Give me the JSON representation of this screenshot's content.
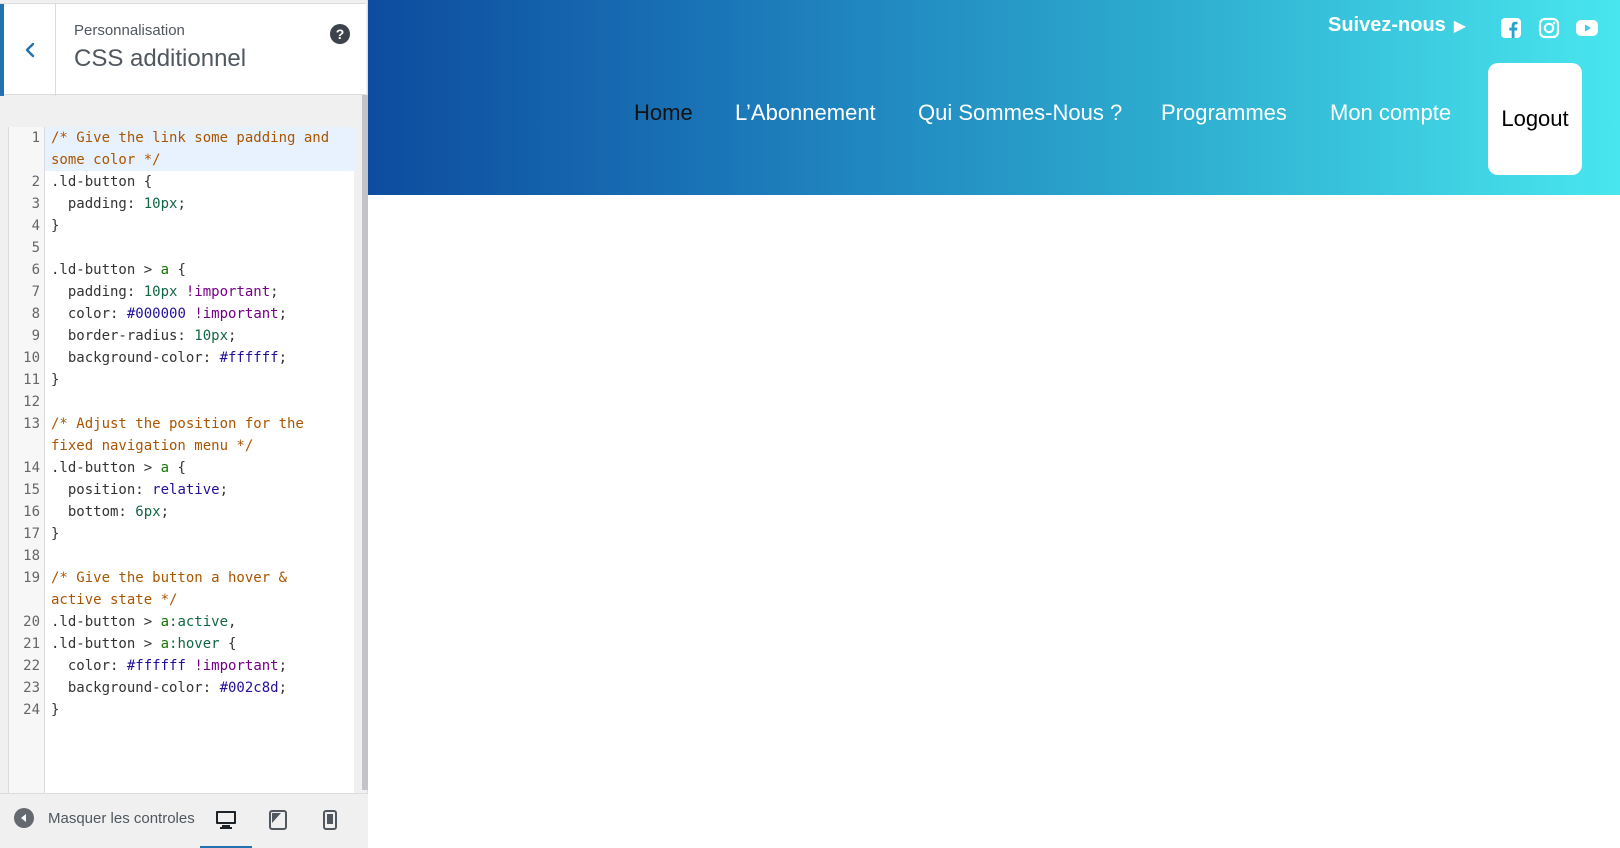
{
  "sidebar": {
    "breadcrumb": "Personnalisation",
    "title": "CSS additionnel",
    "code": [
      [
        {
          "t": "/* Give the link some padding and",
          "c": "comment"
        }
      ],
      [
        {
          "t": "some color */",
          "c": "comment"
        }
      ],
      [
        {
          "t": ".ld-button {",
          "c": ""
        }
      ],
      [
        {
          "t": "  padding: ",
          "c": ""
        },
        {
          "t": "10px",
          "c": "num"
        },
        {
          "t": ";",
          "c": ""
        }
      ],
      [
        {
          "t": "}",
          "c": ""
        }
      ],
      [],
      [
        {
          "t": ".ld-button > ",
          "c": ""
        },
        {
          "t": "a",
          "c": "tag"
        },
        {
          "t": " {",
          "c": ""
        }
      ],
      [
        {
          "t": "  padding: ",
          "c": ""
        },
        {
          "t": "10px",
          "c": "num"
        },
        {
          "t": " ",
          "c": ""
        },
        {
          "t": "!important",
          "c": "kw"
        },
        {
          "t": ";",
          "c": ""
        }
      ],
      [
        {
          "t": "  color: ",
          "c": ""
        },
        {
          "t": "#000000",
          "c": "hex"
        },
        {
          "t": " ",
          "c": ""
        },
        {
          "t": "!important",
          "c": "kw"
        },
        {
          "t": ";",
          "c": ""
        }
      ],
      [
        {
          "t": "  border-radius: ",
          "c": ""
        },
        {
          "t": "10px",
          "c": "num"
        },
        {
          "t": ";",
          "c": ""
        }
      ],
      [
        {
          "t": "  background-color: ",
          "c": ""
        },
        {
          "t": "#ffffff",
          "c": "hex"
        },
        {
          "t": ";",
          "c": ""
        }
      ],
      [
        {
          "t": "}",
          "c": ""
        }
      ],
      [],
      [
        {
          "t": "/* Adjust the position for the",
          "c": "comment"
        }
      ],
      [
        {
          "t": "fixed navigation menu */",
          "c": "comment"
        }
      ],
      [
        {
          "t": ".ld-button > ",
          "c": ""
        },
        {
          "t": "a",
          "c": "tag"
        },
        {
          "t": " {",
          "c": ""
        }
      ],
      [
        {
          "t": "  position: ",
          "c": ""
        },
        {
          "t": "relative",
          "c": "atom"
        },
        {
          "t": ";",
          "c": ""
        }
      ],
      [
        {
          "t": "  bottom: ",
          "c": ""
        },
        {
          "t": "6px",
          "c": "num"
        },
        {
          "t": ";",
          "c": ""
        }
      ],
      [
        {
          "t": "}",
          "c": ""
        }
      ],
      [],
      [
        {
          "t": "/* Give the button a hover &",
          "c": "comment"
        }
      ],
      [
        {
          "t": "active state */",
          "c": "comment"
        }
      ],
      [
        {
          "t": ".ld-button > ",
          "c": ""
        },
        {
          "t": "a",
          "c": "tag"
        },
        {
          "t": ":active",
          "c": "num"
        },
        {
          "t": ",",
          "c": ""
        }
      ],
      [
        {
          "t": ".ld-button > ",
          "c": ""
        },
        {
          "t": "a",
          "c": "tag"
        },
        {
          "t": ":hover",
          "c": "num"
        },
        {
          "t": " {",
          "c": ""
        }
      ],
      [
        {
          "t": "  color: ",
          "c": ""
        },
        {
          "t": "#ffffff",
          "c": "hex"
        },
        {
          "t": " ",
          "c": ""
        },
        {
          "t": "!important",
          "c": "kw"
        },
        {
          "t": ";",
          "c": ""
        }
      ],
      [
        {
          "t": "  background-color: ",
          "c": ""
        },
        {
          "t": "#002c8d",
          "c": "hex"
        },
        {
          "t": ";",
          "c": ""
        }
      ],
      [
        {
          "t": "}",
          "c": ""
        }
      ]
    ],
    "line_numbers": [
      "1",
      "",
      "2",
      "3",
      "4",
      "5",
      "6",
      "7",
      "8",
      "9",
      "10",
      "11",
      "12",
      "13",
      "",
      "14",
      "15",
      "16",
      "17",
      "18",
      "19",
      "",
      "20",
      "21",
      "22",
      "23",
      "24"
    ],
    "footer": {
      "hide_label": "Masquer les controles",
      "devices": [
        "desktop-icon",
        "tablet-icon",
        "mobile-icon"
      ]
    }
  },
  "preview": {
    "follow_label": "Suivez-nous",
    "follow_arrow": "▶",
    "socials": [
      "facebook-icon",
      "instagram-icon",
      "youtube-icon"
    ],
    "nav": [
      "Home",
      "L’Abonnement",
      "Qui Sommes-Nous ?",
      "Programmes",
      "Mon compte"
    ],
    "logout_label": "Logout",
    "colors": {
      "gradient_start": "#0d4c9e",
      "gradient_end": "#48e6ee",
      "accent": "#2271b1"
    }
  }
}
